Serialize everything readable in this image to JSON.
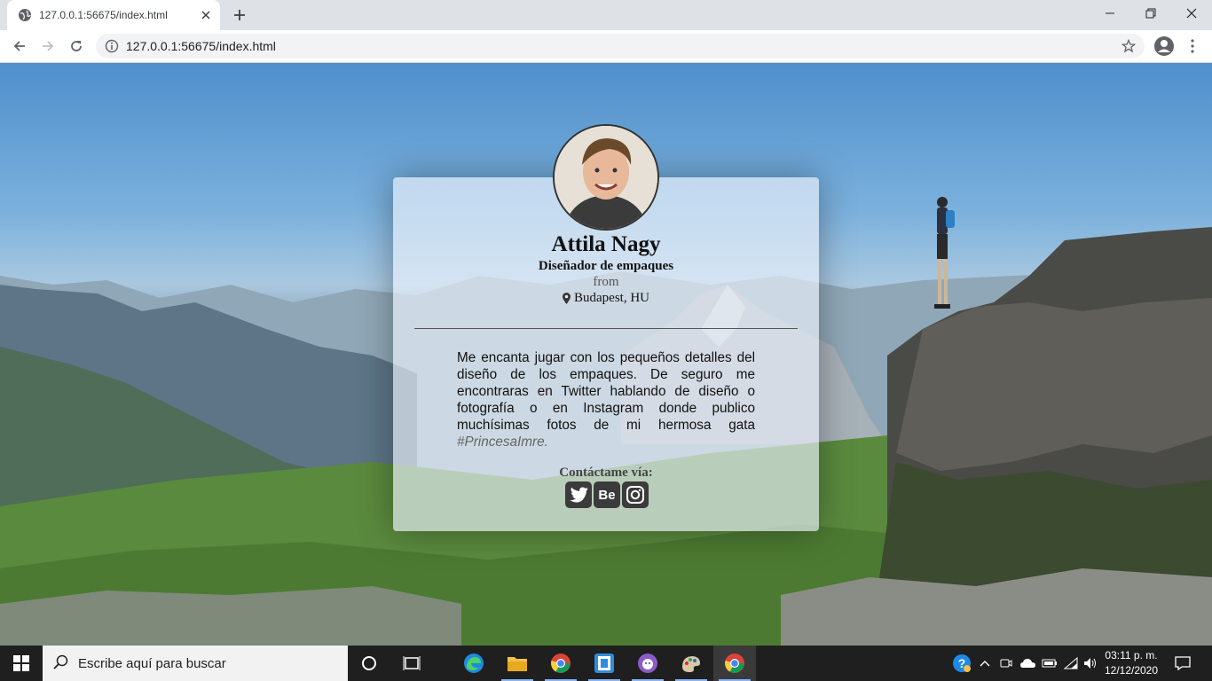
{
  "browser": {
    "tab_title": "127.0.0.1:56675/index.html",
    "url": "127.0.0.1:56675/index.html",
    "icons": {
      "back": "arrow-left-icon",
      "forward": "arrow-right-icon",
      "reload": "reload-icon",
      "site_info": "info-icon",
      "bookmark": "star-icon",
      "profile": "account-icon",
      "menu": "kebab-menu-icon"
    }
  },
  "card": {
    "name": "Attila Nagy",
    "role": "Diseñador de empaques",
    "from_label": "from",
    "location": "Budapest, HU",
    "bio": "Me encanta jugar con los pequeños detalles del diseño de los empaques. De seguro me encontraras en Twitter hablando de diseño o fotografía o en Instagram donde publico muchísimas fotos de mi hermosa gata",
    "bio_hashtag": "#PrincesaImre",
    "bio_end": ".",
    "contact_label": "Contáctame vía:",
    "social": [
      "twitter-icon",
      "behance-icon",
      "instagram-icon"
    ],
    "behance_text": "Be"
  },
  "taskbar": {
    "search_placeholder": "Escribe aquí para buscar",
    "time": "03:11 p. m.",
    "date": "12/12/2020",
    "apps": [
      "cortana",
      "task-view",
      "edge",
      "file-explorer",
      "chrome",
      "app-blue",
      "app-purple",
      "paint",
      "chrome-active"
    ]
  }
}
